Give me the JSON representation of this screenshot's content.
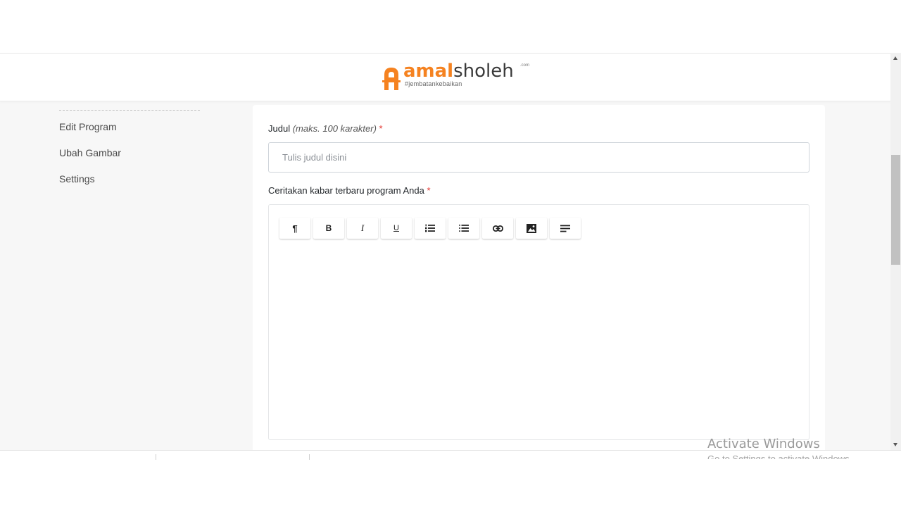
{
  "header": {
    "logo_brand_a": "amal",
    "logo_brand_b": "sholeh",
    "logo_com": ".com",
    "logo_tagline": "#jembatankebaikan"
  },
  "sidebar": {
    "items": [
      {
        "label": "Edit Program"
      },
      {
        "label": "Ubah Gambar"
      },
      {
        "label": "Settings"
      }
    ]
  },
  "form": {
    "title_label": "Judul",
    "title_hint": "(maks. 100 karakter)",
    "required_mark": "*",
    "title_placeholder": "Tulis judul disini",
    "title_value": "",
    "story_label": "Ceritakan kabar terbaru program Anda",
    "toolbar": [
      {
        "name": "paragraph-icon",
        "glyph": "¶"
      },
      {
        "name": "bold-icon",
        "glyph": "B"
      },
      {
        "name": "italic-icon",
        "glyph": "I"
      },
      {
        "name": "underline-icon",
        "glyph": "U"
      },
      {
        "name": "ordered-list-icon",
        "glyph": ""
      },
      {
        "name": "bullet-list-icon",
        "glyph": ""
      },
      {
        "name": "link-icon",
        "glyph": ""
      },
      {
        "name": "image-icon",
        "glyph": ""
      },
      {
        "name": "align-icon",
        "glyph": ""
      }
    ]
  },
  "colors": {
    "brand_orange": "#f58220",
    "required_red": "#e3342f",
    "page_bg": "#f7f7f7"
  },
  "watermark": {
    "title": "Activate Windows",
    "subtitle": "Go to Settings to activate Windows."
  }
}
